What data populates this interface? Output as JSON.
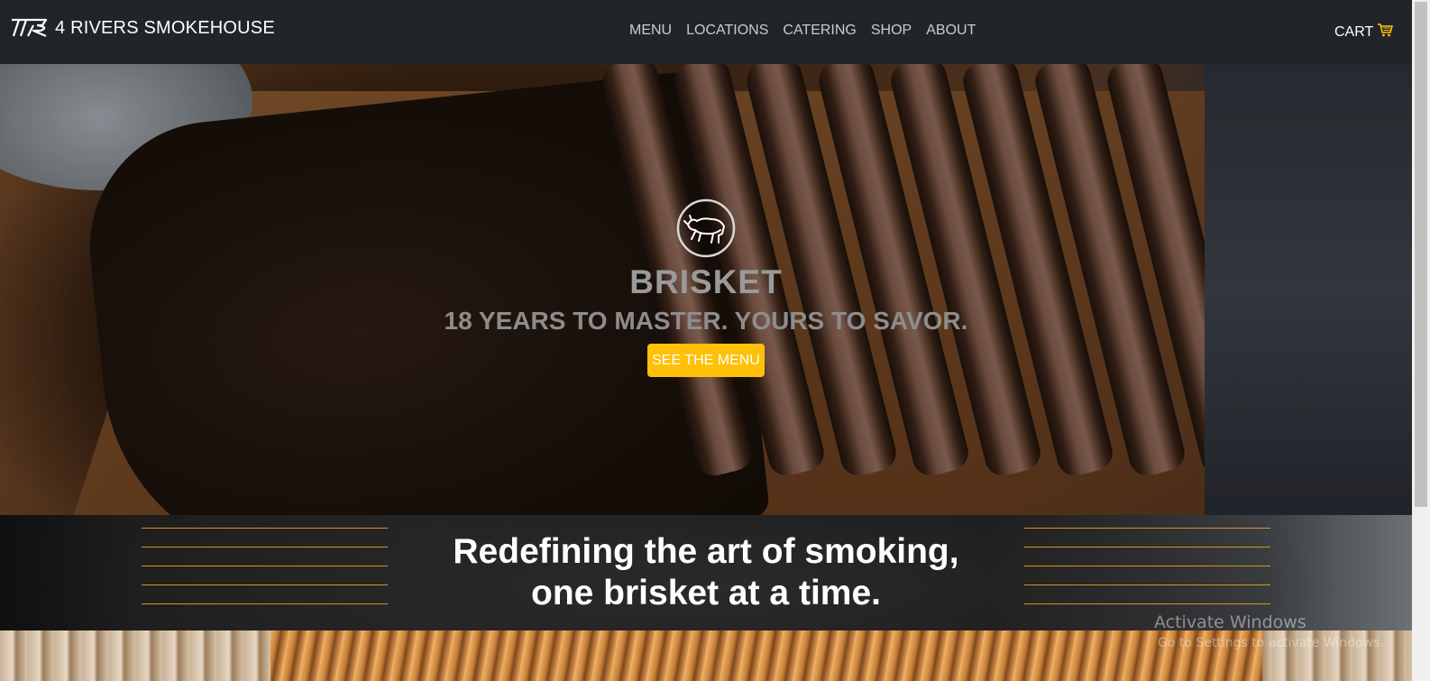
{
  "navbar": {
    "brand": "4 RIVERS SMOKEHOUSE",
    "brand_logo_icon": "4r-logo-icon",
    "links": [
      "MENU",
      "LOCATIONS",
      "CATERING",
      "SHOP",
      "ABOUT"
    ],
    "cart_label": "CART",
    "cart_icon": "shopping-cart-icon"
  },
  "hero": {
    "logo_icon": "bull-icon",
    "title": "BRISKET",
    "subtitle": "18 YEARS TO MASTER. YOURS TO SAVOR.",
    "cta_label": "SEE THE MENU"
  },
  "banner": {
    "line1": "Redefining the art of smoking,",
    "line2": "one brisket at a time."
  },
  "watermark": {
    "title": "Activate Windows",
    "subtitle": "Go to Settings to activate Windows."
  },
  "colors": {
    "navbar_bg": "#212529",
    "accent": "#ffc107",
    "banner_lines": "#d9931f"
  }
}
